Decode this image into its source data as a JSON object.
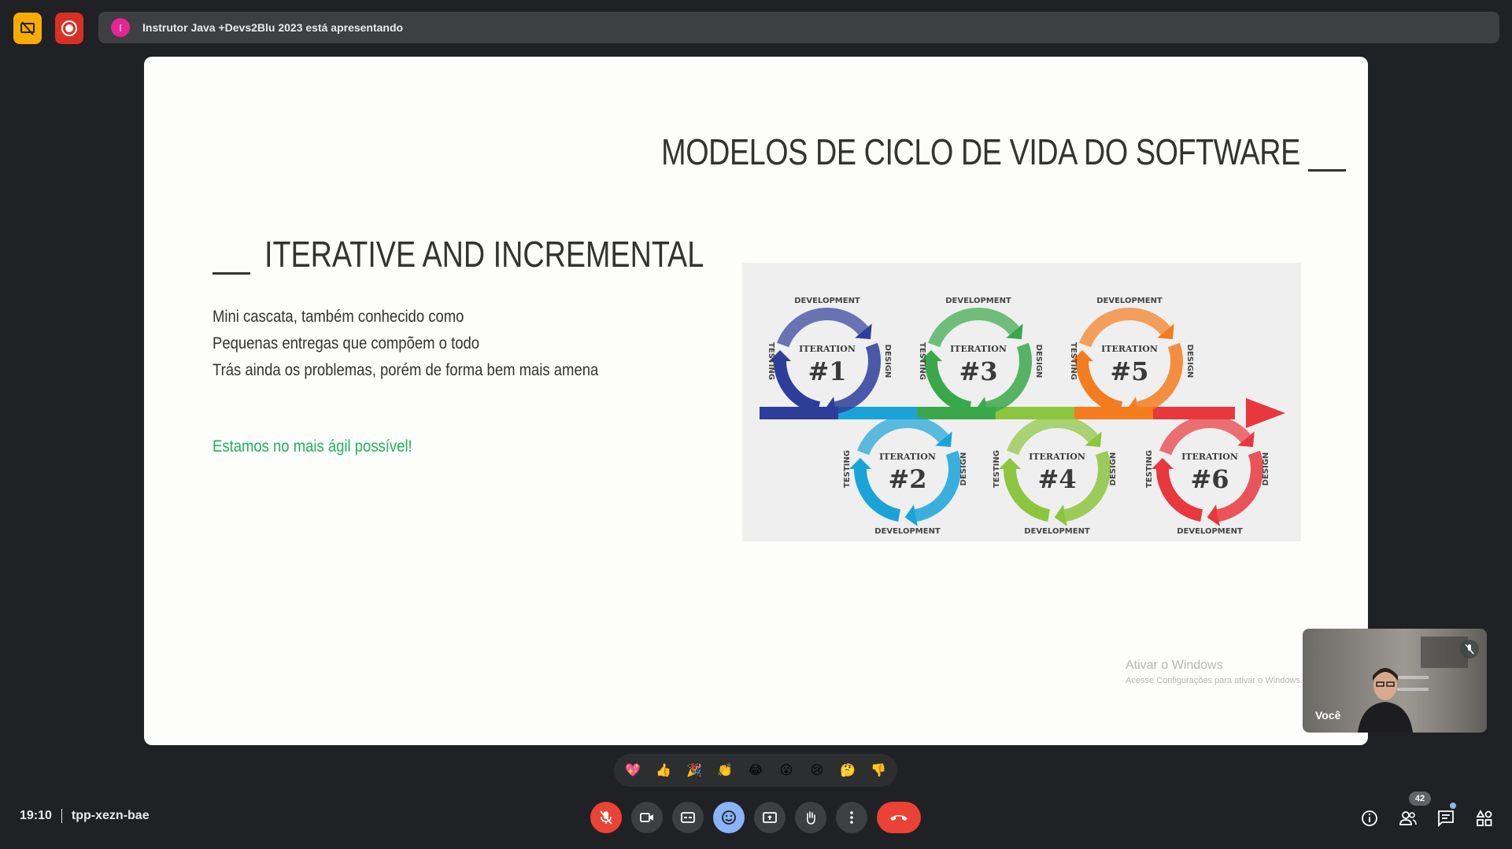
{
  "presentation_bar": {
    "text": "Instrutor Java +Devs2Blu 2023 está apresentando",
    "avatar_letter": "I"
  },
  "slide": {
    "title": "MODELOS DE CICLO DE VIDA DO SOFTWARE",
    "section_title": "ITERATIVE AND INCREMENTAL",
    "bullets": [
      "Mini cascata, também conhecido como",
      "Pequenas entregas que compõem o todo",
      "Trás ainda os problemas, porém de forma bem mais amena"
    ],
    "highlight": "Estamos no mais ágil possível!",
    "diagram": {
      "iterations": [
        {
          "label": "ITERATION",
          "number": "#1",
          "color": "#2d3e9a",
          "top": "DEVELOPMENT",
          "side_left": "TESTING",
          "side_right": "DESIGN"
        },
        {
          "label": "ITERATION",
          "number": "#2",
          "color": "#1aa3d9",
          "top": "DEVELOPMENT",
          "side_left": "TESTING",
          "side_right": "DESIGN"
        },
        {
          "label": "ITERATION",
          "number": "#3",
          "color": "#3aa84a",
          "top": "DEVELOPMENT",
          "side_left": "TESTING",
          "side_right": "DESIGN"
        },
        {
          "label": "ITERATION",
          "number": "#4",
          "color": "#8cc63e",
          "top": "DEVELOPMENT",
          "side_left": "TESTING",
          "side_right": "DESIGN"
        },
        {
          "label": "ITERATION",
          "number": "#5",
          "color": "#f47c20",
          "top": "DEVELOPMENT",
          "side_left": "TESTING",
          "side_right": "DESIGN"
        },
        {
          "label": "ITERATION",
          "number": "#6",
          "color": "#e8383d",
          "top": "DEVELOPMENT",
          "side_left": "TESTING",
          "side_right": "DESIGN"
        }
      ]
    },
    "watermark_line1": "Ativar o Windows",
    "watermark_line2": "Acesse Configurações para ativar o Windows."
  },
  "self_view": {
    "name": "Você"
  },
  "reactions": [
    "💖",
    "👍",
    "🎉",
    "👏",
    "😂",
    "😮",
    "😢",
    "🤔",
    "👎"
  ],
  "meeting": {
    "time": "19:10",
    "code": "tpp-xezn-bae",
    "participants_count": "42"
  },
  "icons": {
    "top_left_1": "screen-off-icon",
    "top_left_2": "record-icon",
    "controls": [
      "mic-off-icon",
      "camera-icon",
      "captions-icon",
      "emoji-icon",
      "present-icon",
      "hand-icon",
      "more-icon",
      "end-call-icon"
    ],
    "right": [
      "info-icon",
      "people-icon",
      "chat-icon",
      "activities-icon"
    ]
  },
  "colors": {
    "background": "#202124",
    "accent_red": "#ea4335",
    "accent_blue": "#8ab4f8",
    "highlight_green": "#1fb25a"
  }
}
